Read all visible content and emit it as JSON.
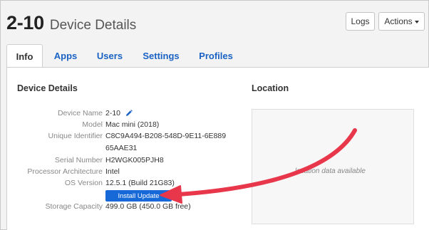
{
  "header": {
    "device_id": "2-10",
    "title": "Device Details",
    "logs_label": "Logs",
    "actions_label": "Actions"
  },
  "tabs": [
    {
      "label": "Info",
      "active": true
    },
    {
      "label": "Apps",
      "active": false
    },
    {
      "label": "Users",
      "active": false
    },
    {
      "label": "Settings",
      "active": false
    },
    {
      "label": "Profiles",
      "active": false
    }
  ],
  "details": {
    "heading": "Device Details",
    "rows": [
      {
        "label": "Device Name",
        "value": "2-10"
      },
      {
        "label": "Model",
        "value": "Mac mini (2018)"
      },
      {
        "label": "Unique Identifier",
        "value": "C8C9A494-B208-548D-9E11-6E889",
        "value2": "65AAE31"
      },
      {
        "label": "Serial Number",
        "value": "H2WGK005PJH8"
      },
      {
        "label": "Processor Architecture",
        "value": "Intel"
      },
      {
        "label": "OS Version",
        "value": "12.5.1 (Build 21G83)"
      },
      {
        "label": "Storage Capacity",
        "value": "499.0 GB (450.0 GB free)"
      }
    ],
    "install_update_label": "Install Update"
  },
  "location": {
    "heading": "Location",
    "empty_text": "location data available"
  },
  "colors": {
    "accent": "#1a62c4",
    "button_primary": "#1769d8",
    "arrow": "#e8364a"
  },
  "icons": {
    "edit": "pencil-icon",
    "dropdown": "caret-down-icon",
    "annotation": "arrow-annotation"
  }
}
